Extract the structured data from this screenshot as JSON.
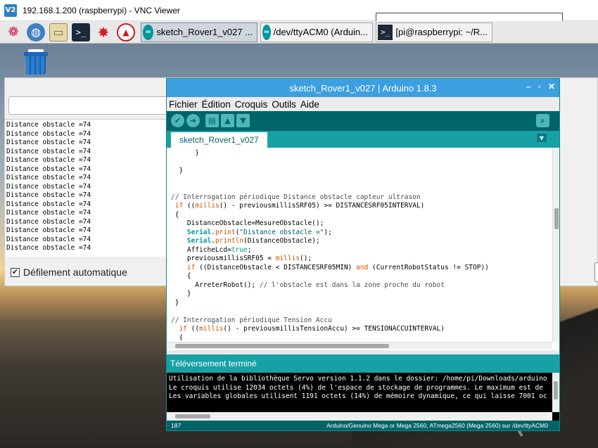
{
  "vnc": {
    "logo": "V2",
    "title": "192.168.1.200 (raspberrypi) - VNC Viewer"
  },
  "taskbar": {
    "icons": [
      "raspberry-menu-icon",
      "web-browser-icon",
      "file-manager-icon",
      "terminal-icon",
      "mathematica-icon",
      "wolfram-icon"
    ],
    "tasks": [
      {
        "label": "sketch_Rover1_v027 ...",
        "icon": "arduino-icon"
      },
      {
        "label": "/dev/ttyACM0 (Arduin...",
        "icon": "arduino-icon"
      },
      {
        "label": "[pi@raspberrypi: ~/R...",
        "icon": "terminal-icon"
      }
    ]
  },
  "serial_monitor": {
    "lines": [
      "Distance obstacle =74",
      "Distance obstacle =74",
      "Distance obstacle =74",
      "Distance obstacle =74",
      "Distance obstacle =74",
      "Distance obstacle =74",
      "Distance obstacle =74",
      "Distance obstacle =74",
      "Distance obstacle =74",
      "Distance obstacle =74",
      "Distance obstacle =74",
      "Distance obstacle =74",
      "Distance obstacle =74",
      "Distance obstacle =74",
      "Distance obstacle =74"
    ],
    "autoscroll_label": "Défilement automatique",
    "autoscroll_checked": "✔"
  },
  "ide": {
    "title": "sketch_Rover1_v027 | Arduino 1.8.3",
    "window_controls": [
      "–",
      "▫",
      "✕"
    ],
    "menu": [
      "Fichier",
      "Édition",
      "Croquis",
      "Outils",
      "Aide"
    ],
    "toolbar": [
      "verify-icon",
      "upload-icon",
      "new-icon",
      "open-icon",
      "save-icon"
    ],
    "tab": "sketch_Rover1_v027",
    "status": "Téléversement terminé",
    "console": [
      "Utilisation de la bibliothèque Servo version 1.1.2 dans le dossier: /home/pi/Downloads/arduino",
      "Le croquis utilise 12034 octets (4%) de l'espace de stockage de programmes. Le maximum est de",
      "Les variables globales utilisent 1191 octets (14%) de mémoire dynamique, ce qui laisse 7001 oc"
    ],
    "footer_line": "187",
    "footer_board": "Arduino/Genuino Mega or Mega 2560, ATmega2560 (Mega 2560) sur /dev/ttyACM0"
  }
}
